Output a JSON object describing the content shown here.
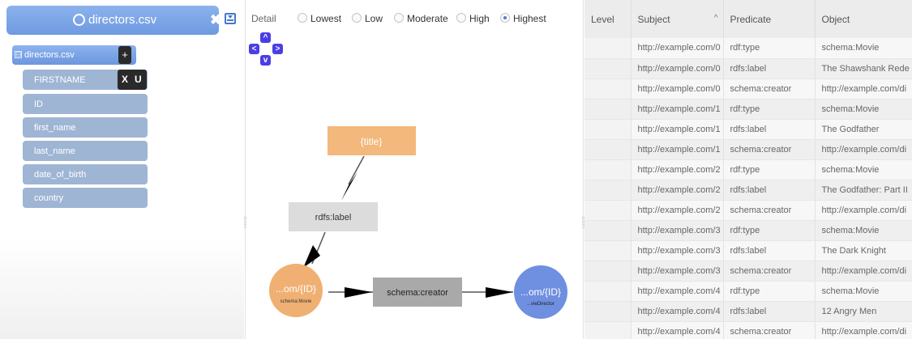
{
  "source_panel": {
    "file_title": "directors.csv",
    "source_label": "directors.csv",
    "toggle_glyph": "⊟",
    "add_glyph": "+",
    "close_glyph": "✖",
    "fields": [
      {
        "label": "FIRSTNAME"
      },
      {
        "label": "ID"
      },
      {
        "label": "first_name"
      },
      {
        "label": "last_name"
      },
      {
        "label": "date_of_birth"
      },
      {
        "label": "country"
      }
    ],
    "field_controls": {
      "x": "X",
      "u": "U"
    }
  },
  "detail": {
    "label": "Detail",
    "options": [
      "Lowest",
      "Low",
      "Moderate",
      "High",
      "Highest"
    ],
    "selected": "Highest"
  },
  "nav_arrows": {
    "up": "^",
    "left": "<",
    "right": ">",
    "down": "v"
  },
  "graph": {
    "title_node": "{title}",
    "label_edge": "rdfs:label",
    "creator_edge": "schema:creator",
    "subject_node": {
      "label": "...om/{ID}",
      "type": "schema:Movie"
    },
    "object_node": {
      "label": "...om/{ID}",
      "type": "...vieDirector"
    },
    "colors": {
      "subject": "#f0b073",
      "object": "#6f8fe0",
      "title": "#f2b87c",
      "edge_box": "#dcdcdc",
      "creator_box": "#a9a9a9"
    }
  },
  "table": {
    "columns": [
      "Level",
      "Subject",
      "Predicate",
      "Object"
    ],
    "sort_indicator": "^",
    "rows": [
      {
        "level": "",
        "subject": "http://example.com/0",
        "predicate": "rdf:type",
        "object": "schema:Movie"
      },
      {
        "level": "",
        "subject": "http://example.com/0",
        "predicate": "rdfs:label",
        "object": "The Shawshank Rede"
      },
      {
        "level": "",
        "subject": "http://example.com/0",
        "predicate": "schema:creator",
        "object": "http://example.com/di"
      },
      {
        "level": "",
        "subject": "http://example.com/1",
        "predicate": "rdf:type",
        "object": "schema:Movie"
      },
      {
        "level": "",
        "subject": "http://example.com/1",
        "predicate": "rdfs:label",
        "object": "The Godfather"
      },
      {
        "level": "",
        "subject": "http://example.com/1",
        "predicate": "schema:creator",
        "object": "http://example.com/di"
      },
      {
        "level": "",
        "subject": "http://example.com/2",
        "predicate": "rdf:type",
        "object": "schema:Movie"
      },
      {
        "level": "",
        "subject": "http://example.com/2",
        "predicate": "rdfs:label",
        "object": "The Godfather: Part II"
      },
      {
        "level": "",
        "subject": "http://example.com/2",
        "predicate": "schema:creator",
        "object": "http://example.com/di"
      },
      {
        "level": "",
        "subject": "http://example.com/3",
        "predicate": "rdf:type",
        "object": "schema:Movie"
      },
      {
        "level": "",
        "subject": "http://example.com/3",
        "predicate": "rdfs:label",
        "object": "The Dark Knight"
      },
      {
        "level": "",
        "subject": "http://example.com/3",
        "predicate": "schema:creator",
        "object": "http://example.com/di"
      },
      {
        "level": "",
        "subject": "http://example.com/4",
        "predicate": "rdf:type",
        "object": "schema:Movie"
      },
      {
        "level": "",
        "subject": "http://example.com/4",
        "predicate": "rdfs:label",
        "object": "12 Angry Men"
      },
      {
        "level": "",
        "subject": "http://example.com/4",
        "predicate": "schema:creator",
        "object": "http://example.com/di"
      }
    ]
  }
}
